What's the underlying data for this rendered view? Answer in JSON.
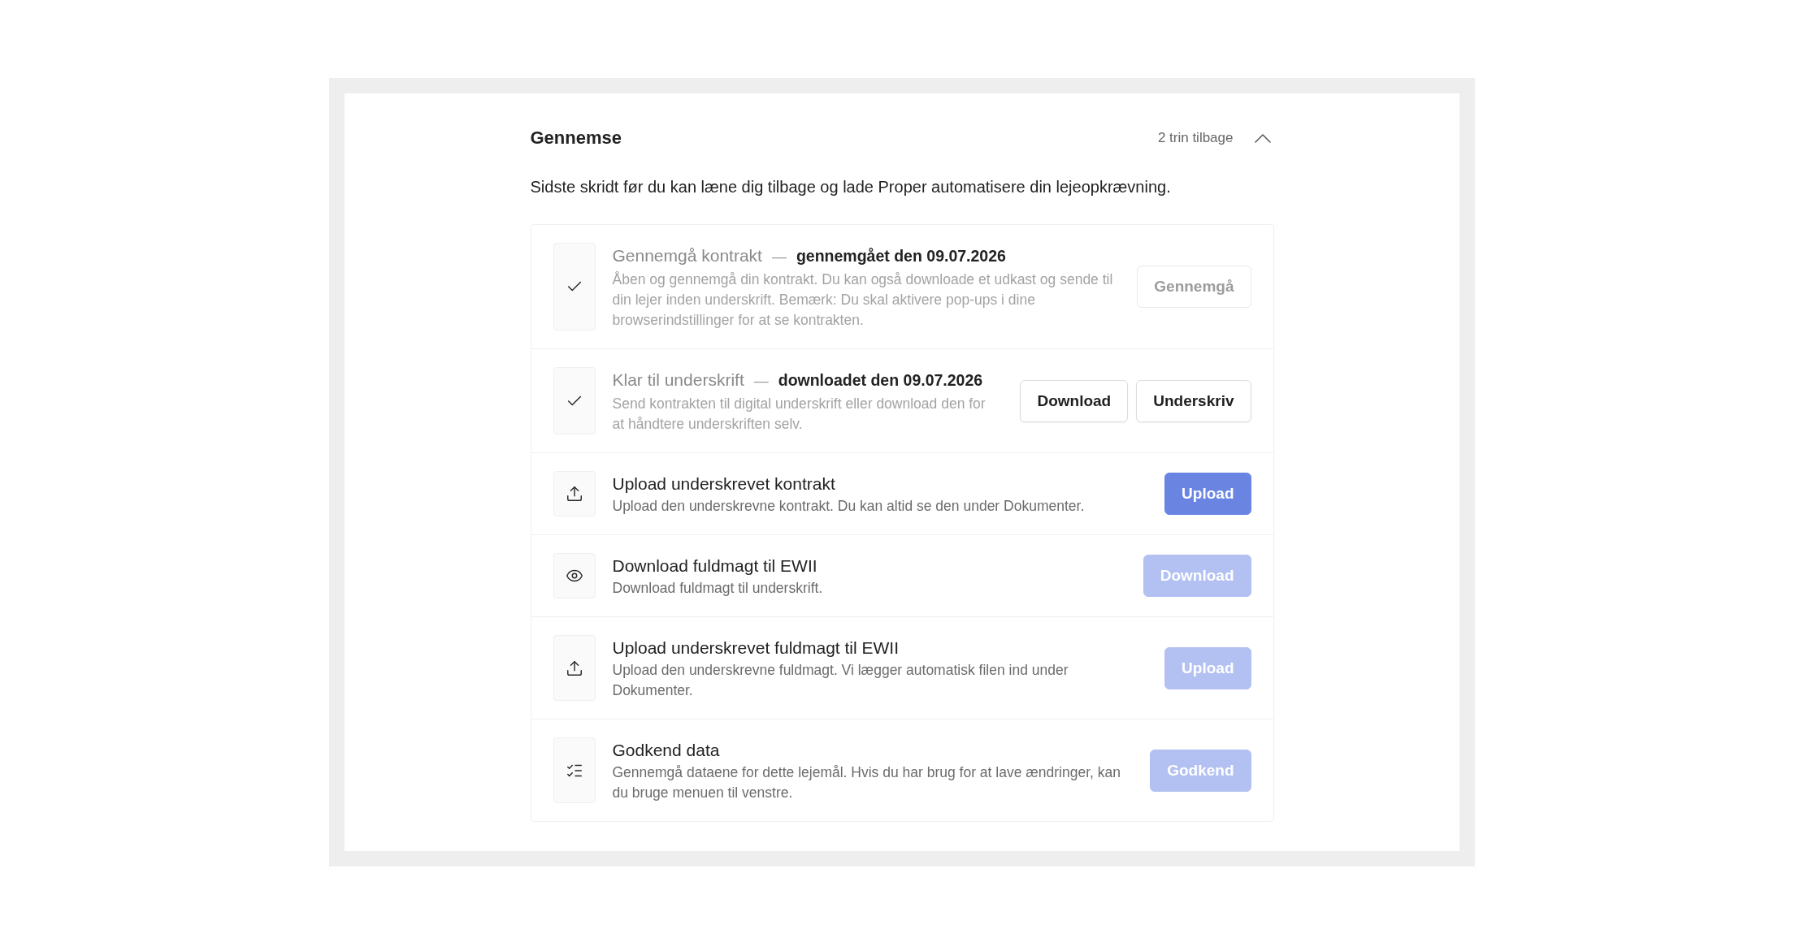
{
  "section": {
    "title": "Gennemse",
    "steps_back": "2 trin tilbage",
    "expanded": true
  },
  "intro": "Sidste skridt før du kan læne dig tilbage og lade Proper automatisere din lejeopkrævning.",
  "steps": [
    {
      "kind": "done",
      "title": "Gennemgå kontrakt",
      "separator": "—",
      "status": "gennemgået den 09.07.2026",
      "description": "Åben og gennemgå din kontrakt. Du kan også downloade et udkast og sende til din lejer inden underskrift. Bemærk: Du skal aktivere pop-ups i dine browserindstillinger for at se kontrakten.",
      "buttons": [
        {
          "label": "Gennemgå",
          "kind": "secondary",
          "disabled": true
        }
      ]
    },
    {
      "kind": "done",
      "title": "Klar til underskrift",
      "separator": "—",
      "status": "downloadet den 09.07.2026",
      "description": "Send kontrakten til digital underskrift eller download den for at håndtere underskriften selv.",
      "buttons": [
        {
          "label": "Download",
          "kind": "secondary",
          "disabled": false
        },
        {
          "label": "Underskriv",
          "kind": "secondary",
          "disabled": false
        }
      ]
    },
    {
      "kind": "upload",
      "title": "Upload underskrevet kontrakt",
      "description": "Upload den underskrevne kontrakt. Du kan altid se den under Dokumenter.",
      "buttons": [
        {
          "label": "Upload",
          "kind": "primary",
          "disabled": false
        }
      ]
    },
    {
      "kind": "view",
      "title": "Download fuldmagt til EWII",
      "description": "Download fuldmagt til underskrift.",
      "buttons": [
        {
          "label": "Download",
          "kind": "primary",
          "disabled": true
        }
      ]
    },
    {
      "kind": "upload",
      "title": "Upload underskrevet fuldmagt til EWII",
      "description": "Upload den underskrevne fuldmagt. Vi lægger automatisk filen ind under Dokumenter.",
      "buttons": [
        {
          "label": "Upload",
          "kind": "primary",
          "disabled": true
        }
      ]
    },
    {
      "kind": "approve",
      "title": "Godkend data",
      "description": "Gennemgå dataene for dette lejemål. Hvis du har brug for at lave ændringer, kan du bruge menuen til venstre.",
      "buttons": [
        {
          "label": "Godkend",
          "kind": "primary",
          "disabled": true
        }
      ]
    }
  ]
}
